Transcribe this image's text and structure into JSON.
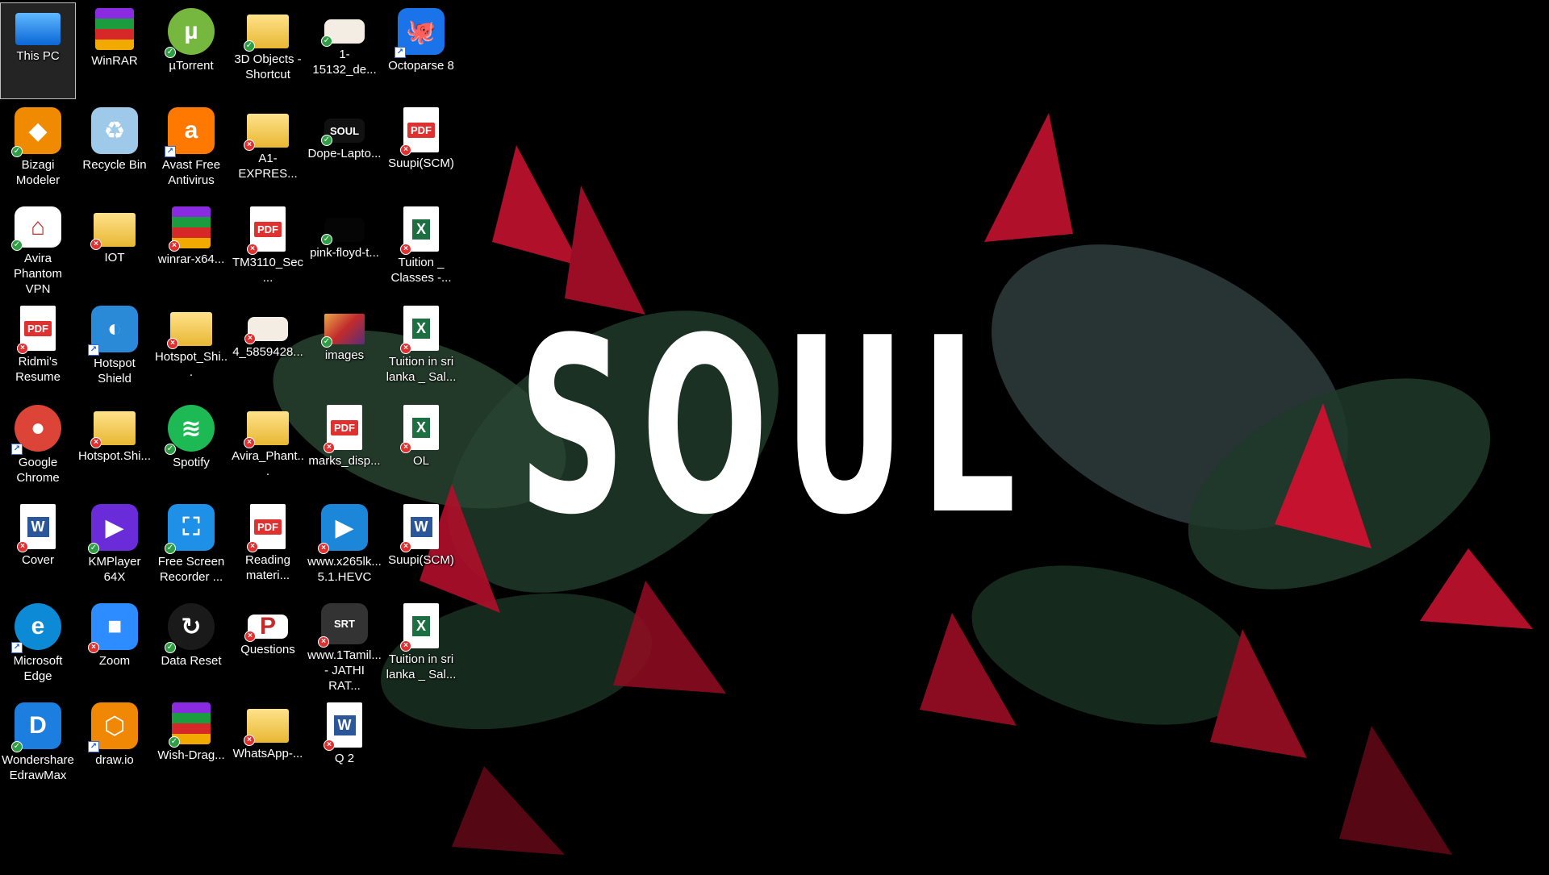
{
  "wallpaper": {
    "title": "SOUL",
    "background": "#000000",
    "leaf_red": "#b0102a",
    "leaf_green": "#1f3a2a"
  },
  "icons": [
    {
      "label": "This PC",
      "icon": "computer-icon",
      "style": "g-pc",
      "glyph_text": "",
      "color": "#1e7fe0",
      "badge": "none",
      "selected": true
    },
    {
      "label": "WinRAR",
      "icon": "winrar-icon",
      "style": "g-rar",
      "glyph_text": "",
      "color": "#8a2be2",
      "badge": "none"
    },
    {
      "label": "µTorrent",
      "icon": "utorrent-icon",
      "style": "g-round",
      "glyph_text": "µ",
      "color": "#76b83f",
      "badge": "ok"
    },
    {
      "label": "3D Objects - Shortcut",
      "icon": "folder-icon",
      "style": "g-folder",
      "glyph_text": "",
      "color": "#f0c040",
      "badge": "ok"
    },
    {
      "label": "1-15132_de...",
      "icon": "image-file-icon",
      "style": "g-pale",
      "glyph_text": "",
      "color": "#f3ede4",
      "badge": "ok"
    },
    {
      "label": "Octoparse 8",
      "icon": "octoparse-icon",
      "style": "g-sq",
      "glyph_text": "🐙",
      "color": "#1a73e8",
      "badge": "shortcut"
    },
    {
      "label": "Bizagi Modeler",
      "icon": "bizagi-icon",
      "style": "g-sq",
      "glyph_text": "◆",
      "color": "#f08a00",
      "badge": "ok"
    },
    {
      "label": "Recycle Bin",
      "icon": "recycle-bin-icon",
      "style": "g-sq",
      "glyph_text": "♻",
      "color": "#9fc9e8",
      "badge": "none"
    },
    {
      "label": "Avast Free Antivirus",
      "icon": "avast-icon",
      "style": "g-sq",
      "glyph_text": "a",
      "color": "#ff7800",
      "badge": "shortcut"
    },
    {
      "label": "A1-EXPRES...",
      "icon": "folder-icon",
      "style": "g-folder",
      "glyph_text": "",
      "color": "#f0c040",
      "badge": "err"
    },
    {
      "label": "Dope-Lapto...",
      "icon": "image-file-icon",
      "style": "g-dark",
      "glyph_text": "SOUL",
      "color": "#111111",
      "badge": "ok"
    },
    {
      "label": "Suupi(SCM)",
      "icon": "pdf-file-icon",
      "style": "g-pdf",
      "glyph_text": "PDF",
      "color": "#ffffff",
      "badge": "err"
    },
    {
      "label": "Avira Phantom VPN",
      "icon": "avira-vpn-icon",
      "style": "g-sq",
      "glyph_text": "⌂",
      "color": "#ffffff",
      "badge": "ok"
    },
    {
      "label": "IOT",
      "icon": "folder-icon",
      "style": "g-folder",
      "glyph_text": "",
      "color": "#f0c040",
      "badge": "err"
    },
    {
      "label": "winrar-x64...",
      "icon": "winrar-installer-icon",
      "style": "g-rar",
      "glyph_text": "",
      "color": "#8a2be2",
      "badge": "err"
    },
    {
      "label": "TM3110_Sec...",
      "icon": "pdf-file-icon",
      "style": "g-pdf",
      "glyph_text": "PDF",
      "color": "#ffffff",
      "badge": "err"
    },
    {
      "label": "pink-floyd-t...",
      "icon": "image-file-icon",
      "style": "g-dark",
      "glyph_text": "",
      "color": "#050505",
      "badge": "ok"
    },
    {
      "label": "Tuition _ Classes -...",
      "icon": "excel-file-icon",
      "style": "g-xls",
      "glyph_text": "X",
      "color": "#ffffff",
      "badge": "err"
    },
    {
      "label": "Ridmi's Resume",
      "icon": "pdf-file-icon",
      "style": "g-pdf",
      "glyph_text": "PDF",
      "color": "#ffffff",
      "badge": "err"
    },
    {
      "label": "Hotspot Shield",
      "icon": "hotspot-shield-icon",
      "style": "g-sq",
      "glyph_text": "◐",
      "color": "#2a8ad8",
      "badge": "shortcut"
    },
    {
      "label": "Hotspot_Shi...",
      "icon": "folder-icon",
      "style": "g-folder",
      "glyph_text": "",
      "color": "#f0c040",
      "badge": "err"
    },
    {
      "label": "4_5859428...",
      "icon": "image-file-icon",
      "style": "g-pale",
      "glyph_text": "",
      "color": "#f3ede4",
      "badge": "err"
    },
    {
      "label": "images",
      "icon": "image-file-icon",
      "style": "g-img",
      "glyph_text": "",
      "color": "#c22b2b",
      "badge": "ok"
    },
    {
      "label": "Tuition in sri lanka _ Sal...",
      "icon": "excel-file-icon",
      "style": "g-xls",
      "glyph_text": "X",
      "color": "#ffffff",
      "badge": "err"
    },
    {
      "label": "Google Chrome",
      "icon": "chrome-icon",
      "style": "g-round",
      "glyph_text": "●",
      "color": "#db4437",
      "badge": "shortcut"
    },
    {
      "label": "Hotspot.Shi...",
      "icon": "folder-icon",
      "style": "g-folder",
      "glyph_text": "",
      "color": "#f0c040",
      "badge": "err"
    },
    {
      "label": "Spotify",
      "icon": "spotify-icon",
      "style": "g-round",
      "glyph_text": "≋",
      "color": "#1db954",
      "badge": "ok"
    },
    {
      "label": "Avira_Phant...",
      "icon": "folder-icon",
      "style": "g-folder",
      "glyph_text": "",
      "color": "#f0c040",
      "badge": "err"
    },
    {
      "label": "marks_disp...",
      "icon": "pdf-file-icon",
      "style": "g-pdf",
      "glyph_text": "PDF",
      "color": "#ffffff",
      "badge": "err"
    },
    {
      "label": "OL",
      "icon": "excel-file-icon",
      "style": "g-xls",
      "glyph_text": "X",
      "color": "#ffffff",
      "badge": "err"
    },
    {
      "label": "Cover",
      "icon": "word-file-icon",
      "style": "g-doc",
      "glyph_text": "W",
      "color": "#ffffff",
      "badge": "err"
    },
    {
      "label": "KMPlayer 64X",
      "icon": "kmplayer-icon",
      "style": "g-sq",
      "glyph_text": "▶",
      "color": "#6a2bd8",
      "badge": "ok"
    },
    {
      "label": "Free Screen Recorder ...",
      "icon": "screen-recorder-icon",
      "style": "g-sq",
      "glyph_text": "⛶",
      "color": "#1e90e8",
      "badge": "ok"
    },
    {
      "label": "Reading materi...",
      "icon": "pdf-file-icon",
      "style": "g-pdf",
      "glyph_text": "PDF",
      "color": "#ffffff",
      "badge": "err"
    },
    {
      "label": "www.x265lk... 5.1.HEVC",
      "icon": "video-file-icon",
      "style": "g-sq",
      "glyph_text": "▶",
      "color": "#1c86d8",
      "badge": "err"
    },
    {
      "label": "Suupi(SCM)",
      "icon": "word-file-icon",
      "style": "g-doc",
      "glyph_text": "W",
      "color": "#ffffff",
      "badge": "err"
    },
    {
      "label": "Microsoft Edge",
      "icon": "edge-icon",
      "style": "g-round",
      "glyph_text": "e",
      "color": "#0c8ad6",
      "badge": "shortcut"
    },
    {
      "label": "Zoom",
      "icon": "zoom-icon",
      "style": "g-sq",
      "glyph_text": "■",
      "color": "#2d8cff",
      "badge": "err"
    },
    {
      "label": "Data Reset",
      "icon": "data-reset-icon",
      "style": "g-round",
      "glyph_text": "↻",
      "color": "#1a1a1a",
      "badge": "ok"
    },
    {
      "label": "Questions",
      "icon": "powerpoint-file-icon",
      "style": "g-pale",
      "glyph_text": "P",
      "color": "#ffffff",
      "badge": "err"
    },
    {
      "label": "www.1Tamil... - JATHI RAT...",
      "icon": "srt-file-icon",
      "style": "g-sq",
      "glyph_text": "SRT",
      "color": "#333333",
      "badge": "err"
    },
    {
      "label": "Tuition in sri lanka _ Sal...",
      "icon": "excel-file-icon",
      "style": "g-xls",
      "glyph_text": "X",
      "color": "#ffffff",
      "badge": "err"
    },
    {
      "label": "Wondershare EdrawMax",
      "icon": "edrawmax-icon",
      "style": "g-sq",
      "glyph_text": "D",
      "color": "#1c7fe0",
      "badge": "ok"
    },
    {
      "label": "draw.io",
      "icon": "drawio-icon",
      "style": "g-sq",
      "glyph_text": "⬡",
      "color": "#f08705",
      "badge": "shortcut"
    },
    {
      "label": "Wish-Drag...",
      "icon": "winrar-archive-icon",
      "style": "g-rar",
      "glyph_text": "",
      "color": "#8a2be2",
      "badge": "ok"
    },
    {
      "label": "WhatsApp-...",
      "icon": "folder-icon",
      "style": "g-folder",
      "glyph_text": "",
      "color": "#f0c040",
      "badge": "err"
    },
    {
      "label": "Q 2",
      "icon": "word-file-icon",
      "style": "g-doc",
      "glyph_text": "W",
      "color": "#ffffff",
      "badge": "err"
    }
  ]
}
